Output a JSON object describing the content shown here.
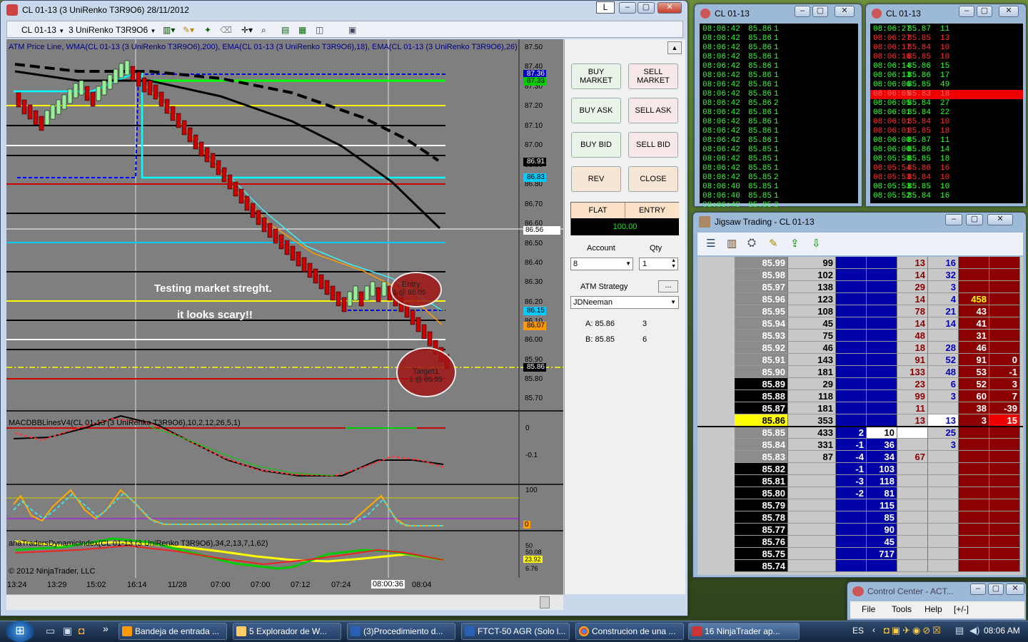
{
  "chart_window": {
    "title": "CL 01-13 (3 UniRenko T3R9O6)  28/11/2012",
    "instrument": "CL 01-13",
    "period": "3 UniRenko T3R9O6",
    "indicator_label": "ATM Price Line, WMA(CL 01-13 (3 UniRenko T3R9O6),200), EMA(CL 01-13 (3 UniRenko T3R9O6),18), EMA(CL 01-13 (3 UniRenko T3R9O6),26)",
    "annotation1": "Testing market streght.",
    "annotation2": "it looks scary!!",
    "entry_label": "Entry",
    "entry_detail": "1 @ 86.05",
    "target_label": "Target1",
    "target_detail": "1 @ 85.95",
    "price_ticks": [
      "87.50",
      "87.40",
      "87.30",
      "87.20",
      "87.10",
      "87.00",
      "86.90",
      "86.80",
      "86.70",
      "86.60",
      "86.50",
      "86.40",
      "86.30",
      "86.20",
      "86.10",
      "86.00",
      "85.90",
      "85.80",
      "85.70"
    ],
    "price_markers": {
      "p1": "87.36",
      "p2": "87.33",
      "p3": "86.91",
      "p4": "86.83",
      "p5": "86.56",
      "p6": "86.15",
      "p7": "86.07",
      "p8": "85.86"
    },
    "macd_label": "MACDBBLinesV4(CL 01-13 (3 UniRenko T3R9O6),10,2,12,26,5,1)",
    "macd_ticks": [
      "0",
      "-0.1"
    ],
    "stoch_ticks": [
      "100",
      "0"
    ],
    "tdi_label": "anaTradersDynamicIndex(CL 01-13 (3 UniRenko T3R9O6),34,2,13,7,1,62)",
    "tdi_ticks": [
      "50",
      "50.08",
      "23.92",
      "6.76"
    ],
    "copyright": "© 2012 NinjaTrader, LLC",
    "time_labels": [
      "13:24",
      "13:29",
      "15:02",
      "16:14",
      "11/28",
      "07:00",
      "07:00",
      "07:12",
      "07:24",
      "08:00:36",
      "08:04"
    ],
    "l_button": "L"
  },
  "order_panel": {
    "buy_market": "BUY MARKET",
    "sell_market": "SELL MARKET",
    "buy_ask": "BUY ASK",
    "sell_ask": "SELL ASK",
    "buy_bid": "BUY BID",
    "sell_bid": "SELL BID",
    "rev": "REV",
    "close": "CLOSE",
    "flat": "FLAT",
    "entry": "ENTRY",
    "price": "100.00",
    "account_label": "Account",
    "qty_label": "Qty",
    "account_value": "8",
    "qty_value": "1",
    "atm_label": "ATM Strategy",
    "atm_button": "...",
    "atm_value": "JDNeeman",
    "ask_label": "A: 85.86",
    "ask_size": "3",
    "bid_label": "B: 85.85",
    "bid_size": "6"
  },
  "ts1": {
    "title": "CL 01-13",
    "rows": [
      [
        "08:06:42",
        "85.86",
        "1"
      ],
      [
        "08:06:42",
        "85.86",
        "1"
      ],
      [
        "08:06:42",
        "85.86",
        "1"
      ],
      [
        "08:06:42",
        "85.86",
        "1"
      ],
      [
        "08:06:42",
        "85.86",
        "1"
      ],
      [
        "08:06:42",
        "85.86",
        "1"
      ],
      [
        "08:06:42",
        "85.86",
        "1"
      ],
      [
        "08:06:42",
        "85.86",
        "1"
      ],
      [
        "08:06:42",
        "85.86",
        "2"
      ],
      [
        "08:06:42",
        "85.86",
        "1"
      ],
      [
        "08:06:42",
        "85.86",
        "1"
      ],
      [
        "08:06:42",
        "85.86",
        "1"
      ],
      [
        "08:06:42",
        "85.86",
        "1"
      ],
      [
        "08:06:42",
        "85.85",
        "1"
      ],
      [
        "08:06:42",
        "85.85",
        "1"
      ],
      [
        "08:06:42",
        "85.85",
        "1"
      ],
      [
        "08:06:42",
        "85.85",
        "2"
      ],
      [
        "08:06:40",
        "85.85",
        "1"
      ],
      [
        "08:06:40",
        "85.85",
        "1"
      ],
      [
        "08:06:40",
        "85.85",
        "3"
      ]
    ]
  },
  "ts2": {
    "title": "CL 01-13",
    "rows": [
      [
        "08:06:27",
        "85.87",
        "11",
        "g"
      ],
      [
        "08:06:27",
        "85.85",
        "13",
        "r"
      ],
      [
        "08:06:17",
        "85.84",
        "10",
        "r"
      ],
      [
        "08:06:16",
        "85.85",
        "10",
        "r"
      ],
      [
        "08:06:14",
        "85.86",
        "15",
        "g"
      ],
      [
        "08:06:13",
        "85.86",
        "17",
        "g"
      ],
      [
        "08:06:06",
        "85.85",
        "49",
        "g"
      ],
      [
        "08:06:05",
        "85.83",
        "18",
        "hl"
      ],
      [
        "08:06:05",
        "85.84",
        "27",
        "g"
      ],
      [
        "08:06:01",
        "85.84",
        "22",
        "g"
      ],
      [
        "08:06:01",
        "85.84",
        "10",
        "r"
      ],
      [
        "08:06:01",
        "85.85",
        "18",
        "r"
      ],
      [
        "08:06:00",
        "85.87",
        "11",
        "g"
      ],
      [
        "08:06:00",
        "85.86",
        "14",
        "g"
      ],
      [
        "08:05:58",
        "85.85",
        "18",
        "g"
      ],
      [
        "08:05:54",
        "85.86",
        "16",
        "r"
      ],
      [
        "08:05:53",
        "85.84",
        "10",
        "r"
      ],
      [
        "08:05:53",
        "85.85",
        "10",
        "g"
      ],
      [
        "08:05:52",
        "85.84",
        "16",
        "g"
      ]
    ]
  },
  "jigsaw": {
    "title": "Jigsaw Trading - CL 01-13",
    "rows": [
      {
        "price": "85.99",
        "vol": "99",
        "b1": "",
        "b2": "",
        "s1": "13",
        "s2": "16",
        "a1": "",
        "a2": ""
      },
      {
        "price": "85.98",
        "vol": "102",
        "b1": "",
        "b2": "",
        "s1": "14",
        "s2": "32",
        "a1": "",
        "a2": ""
      },
      {
        "price": "85.97",
        "vol": "138",
        "b1": "",
        "b2": "",
        "s1": "29",
        "s2": "3",
        "a1": "",
        "a2": ""
      },
      {
        "price": "85.96",
        "vol": "123",
        "b1": "",
        "b2": "",
        "s1": "14",
        "s2": "4",
        "a1": "458",
        "a2": ""
      },
      {
        "price": "85.95",
        "vol": "108",
        "b1": "",
        "b2": "",
        "s1": "78",
        "s2": "21",
        "a1": "43",
        "a2": ""
      },
      {
        "price": "85.94",
        "vol": "45",
        "b1": "",
        "b2": "",
        "s1": "14",
        "s2": "14",
        "a1": "41",
        "a2": ""
      },
      {
        "price": "85.93",
        "vol": "75",
        "b1": "",
        "b2": "",
        "s1": "48",
        "s2": "",
        "a1": "31",
        "a2": ""
      },
      {
        "price": "85.92",
        "vol": "46",
        "b1": "",
        "b2": "",
        "s1": "18",
        "s2": "28",
        "a1": "46",
        "a2": ""
      },
      {
        "price": "85.91",
        "vol": "143",
        "b1": "",
        "b2": "",
        "s1": "91",
        "s2": "52",
        "a1": "91",
        "a2": "0"
      },
      {
        "price": "85.90",
        "vol": "181",
        "b1": "",
        "b2": "",
        "s1": "133",
        "s2": "48",
        "a1": "53",
        "a2": "-1"
      },
      {
        "price": "85.89",
        "vol": "29",
        "b1": "",
        "b2": "",
        "s1": "23",
        "s2": "6",
        "a1": "52",
        "a2": "3"
      },
      {
        "price": "85.88",
        "vol": "118",
        "b1": "",
        "b2": "",
        "s1": "99",
        "s2": "3",
        "a1": "60",
        "a2": "7"
      },
      {
        "price": "85.87",
        "vol": "181",
        "b1": "",
        "b2": "",
        "s1": "11",
        "s2": "",
        "a1": "38",
        "a2": "-39"
      },
      {
        "price": "85.86",
        "vol": "353",
        "b1": "",
        "b2": "",
        "s1": "13",
        "s2": "13",
        "a1": "3",
        "a2": "15"
      },
      {
        "price": "85.85",
        "vol": "433",
        "b1": "2",
        "b2": "10",
        "s1": "",
        "s2": "25",
        "a1": "",
        "a2": ""
      },
      {
        "price": "85.84",
        "vol": "331",
        "b1": "-1",
        "b2": "36",
        "s1": "",
        "s2": "3",
        "a1": "",
        "a2": ""
      },
      {
        "price": "85.83",
        "vol": "87",
        "b1": "-4",
        "b2": "34",
        "s1": "67",
        "s2": "",
        "a1": "",
        "a2": ""
      },
      {
        "price": "85.82",
        "vol": "",
        "b1": "-1",
        "b2": "103",
        "s1": "",
        "s2": "",
        "a1": "",
        "a2": ""
      },
      {
        "price": "85.81",
        "vol": "",
        "b1": "-3",
        "b2": "118",
        "s1": "",
        "s2": "",
        "a1": "",
        "a2": ""
      },
      {
        "price": "85.80",
        "vol": "",
        "b1": "-2",
        "b2": "81",
        "s1": "",
        "s2": "",
        "a1": "",
        "a2": ""
      },
      {
        "price": "85.79",
        "vol": "",
        "b1": "",
        "b2": "115",
        "s1": "",
        "s2": "",
        "a1": "",
        "a2": ""
      },
      {
        "price": "85.78",
        "vol": "",
        "b1": "",
        "b2": "85",
        "s1": "",
        "s2": "",
        "a1": "",
        "a2": ""
      },
      {
        "price": "85.77",
        "vol": "",
        "b1": "",
        "b2": "90",
        "s1": "",
        "s2": "",
        "a1": "",
        "a2": ""
      },
      {
        "price": "85.76",
        "vol": "",
        "b1": "",
        "b2": "45",
        "s1": "",
        "s2": "",
        "a1": "",
        "a2": ""
      },
      {
        "price": "85.75",
        "vol": "",
        "b1": "",
        "b2": "717",
        "s1": "",
        "s2": "",
        "a1": "",
        "a2": ""
      },
      {
        "price": "85.74",
        "vol": "",
        "b1": "",
        "b2": "",
        "s1": "",
        "s2": "",
        "a1": "",
        "a2": ""
      }
    ]
  },
  "control_center": {
    "title": "Control Center - ACT...",
    "menu": [
      "File",
      "Tools",
      "Help",
      "[+/-]"
    ]
  },
  "taskbar": {
    "items": [
      "Bandeja de entrada ...",
      "5 Explorador de W...",
      "(3)Procedimiento d...",
      "FTCT-50 AGR (Solo l...",
      "Construcion de una ...",
      "16 NinjaTrader ap..."
    ],
    "lang": "ES",
    "clock": "08:06 AM",
    "chevron": "»"
  },
  "colors": {
    "bull": "#9be39b",
    "bear": "#c00000",
    "chart_bg": "#7f7f7f",
    "dom_blue": "#0000a8",
    "dom_red": "#8b0000"
  }
}
